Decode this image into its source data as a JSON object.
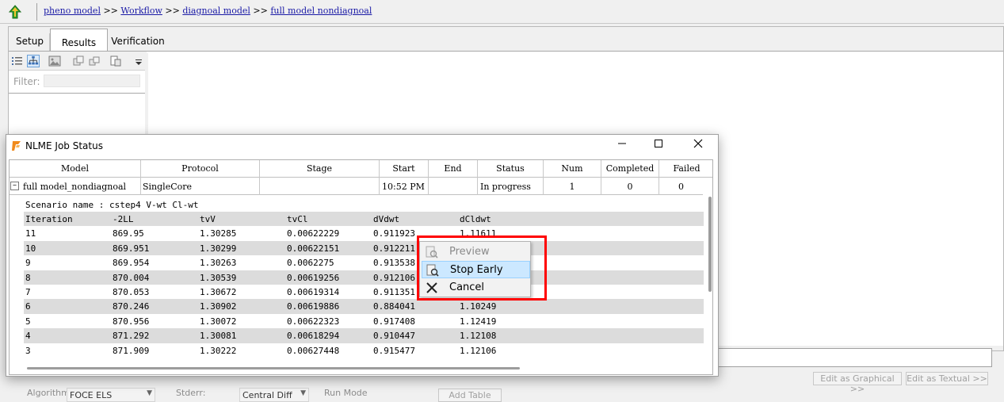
{
  "breadcrumb": {
    "items": [
      "pheno model",
      "Workflow",
      "diagnoal model",
      "full model nondiagnoal"
    ],
    "separator": ">>"
  },
  "tabs": {
    "setup": "Setup",
    "results": "Results",
    "verification": "Verification"
  },
  "left_panel": {
    "filter_label": "Filter:",
    "filter_value": ""
  },
  "bottom": {
    "algorithm_label": "Algorithm",
    "algorithm_value": "FOCE ELS",
    "stderr_label": "Stderr:",
    "stderr_value": "Central Diff",
    "run_mode_label": "Run Mode",
    "add_table": "Add Table",
    "edit_graphical": "Edit as Graphical >>",
    "edit_textual": "Edit as Textual >>"
  },
  "job_window": {
    "title": "NLME Job Status",
    "columns": [
      "Model",
      "Protocol",
      "Stage",
      "Start",
      "End",
      "Status",
      "Num",
      "Completed",
      "Failed"
    ],
    "job": {
      "model": "full model_nondiagnoal",
      "protocol": "SingleCore",
      "stage": "",
      "start": "10:52 PM",
      "end": "",
      "status": "In progress",
      "num": "1",
      "completed": "0",
      "failed": "0"
    },
    "scenario": "Scenario name : cstep4 V-wt Cl-wt",
    "iteration_columns": [
      "Iteration",
      "-2LL",
      "tvV",
      "tvCl",
      "dVdwt",
      "dCldwt"
    ],
    "iterations": [
      [
        "11",
        "869.95",
        "1.30285",
        "0.00622229",
        "0.911923",
        "1.11611"
      ],
      [
        "10",
        "869.951",
        "1.30299",
        "0.00622151",
        "0.912211",
        ""
      ],
      [
        "9",
        "869.954",
        "1.30263",
        "0.0062275",
        "0.913538",
        ""
      ],
      [
        "8",
        "870.004",
        "1.30539",
        "0.00619256",
        "0.912106",
        ""
      ],
      [
        "7",
        "870.053",
        "1.30672",
        "0.00619314",
        "0.911351",
        ""
      ],
      [
        "6",
        "870.246",
        "1.30902",
        "0.00619886",
        "0.884041",
        "1.10249"
      ],
      [
        "5",
        "870.956",
        "1.30072",
        "0.00622323",
        "0.917408",
        "1.12419"
      ],
      [
        "4",
        "871.292",
        "1.30081",
        "0.00618294",
        "0.910447",
        "1.12108"
      ],
      [
        "3",
        "871.909",
        "1.30222",
        "0.00627448",
        "0.915477",
        "1.12106"
      ]
    ]
  },
  "context_menu": {
    "preview": "Preview",
    "stop_early": "Stop Early",
    "cancel": "Cancel"
  },
  "colors": {
    "highlight": "#ff0000",
    "link": "#1a1aa6",
    "menu_selected": "#cce8ff",
    "row_shade": "#dcdcdc"
  }
}
